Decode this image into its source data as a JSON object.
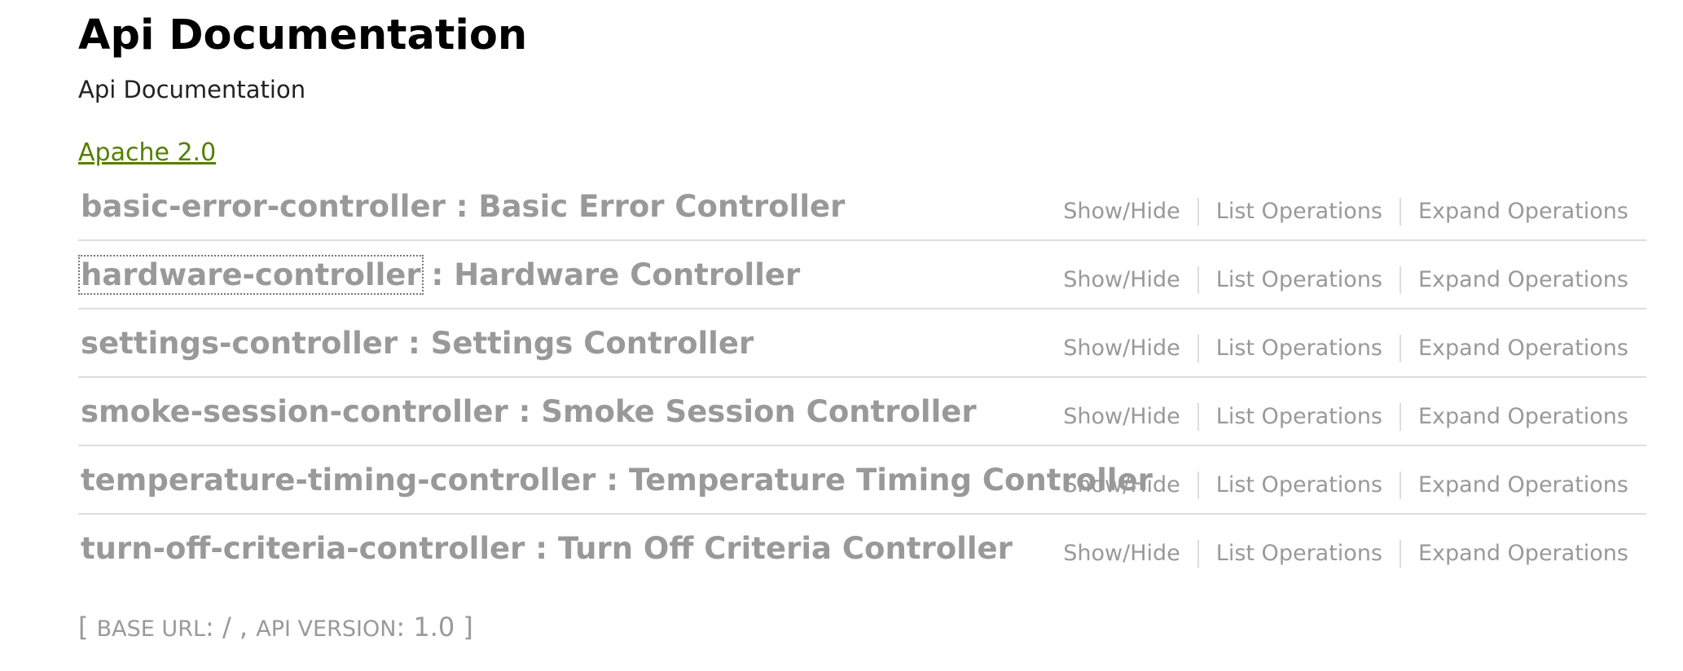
{
  "header": {
    "title": "Api Documentation",
    "description": "Api Documentation",
    "license_label": "Apache 2.0"
  },
  "resources": [
    {
      "name": "basic-error-controller",
      "separator": " : ",
      "description": "Basic Error Controller",
      "show_hide": "Show/Hide",
      "list_ops": "List Operations",
      "expand_ops": "Expand Operations"
    },
    {
      "name": "hardware-controller",
      "separator": " : ",
      "description": "Hardware Controller",
      "show_hide": "Show/Hide",
      "list_ops": "List Operations",
      "expand_ops": "Expand Operations"
    },
    {
      "name": "settings-controller",
      "separator": " : ",
      "description": "Settings Controller",
      "show_hide": "Show/Hide",
      "list_ops": "List Operations",
      "expand_ops": "Expand Operations"
    },
    {
      "name": "smoke-session-controller",
      "separator": " : ",
      "description": "Smoke Session Controller",
      "show_hide": "Show/Hide",
      "list_ops": "List Operations",
      "expand_ops": "Expand Operations"
    },
    {
      "name": "temperature-timing-controller",
      "separator": " : ",
      "description": "Temperature Timing Controller",
      "show_hide": "Show/Hide",
      "list_ops": "List Operations",
      "expand_ops": "Expand Operations"
    },
    {
      "name": "turn-off-criteria-controller",
      "separator": " : ",
      "description": "Turn Off Criteria Controller",
      "show_hide": "Show/Hide",
      "list_ops": "List Operations",
      "expand_ops": "Expand Operations"
    }
  ],
  "footer": {
    "open_bracket": "[ ",
    "base_url_label": "BASE URL",
    "base_url_value": ": / , ",
    "api_version_label": "API VERSION",
    "api_version_colon": ": ",
    "api_version_value": "1.0",
    "close_bracket": " ]"
  },
  "colors": {
    "title": "#000000",
    "link": "#547f00",
    "muted": "#999999",
    "divider": "#dddddd"
  }
}
